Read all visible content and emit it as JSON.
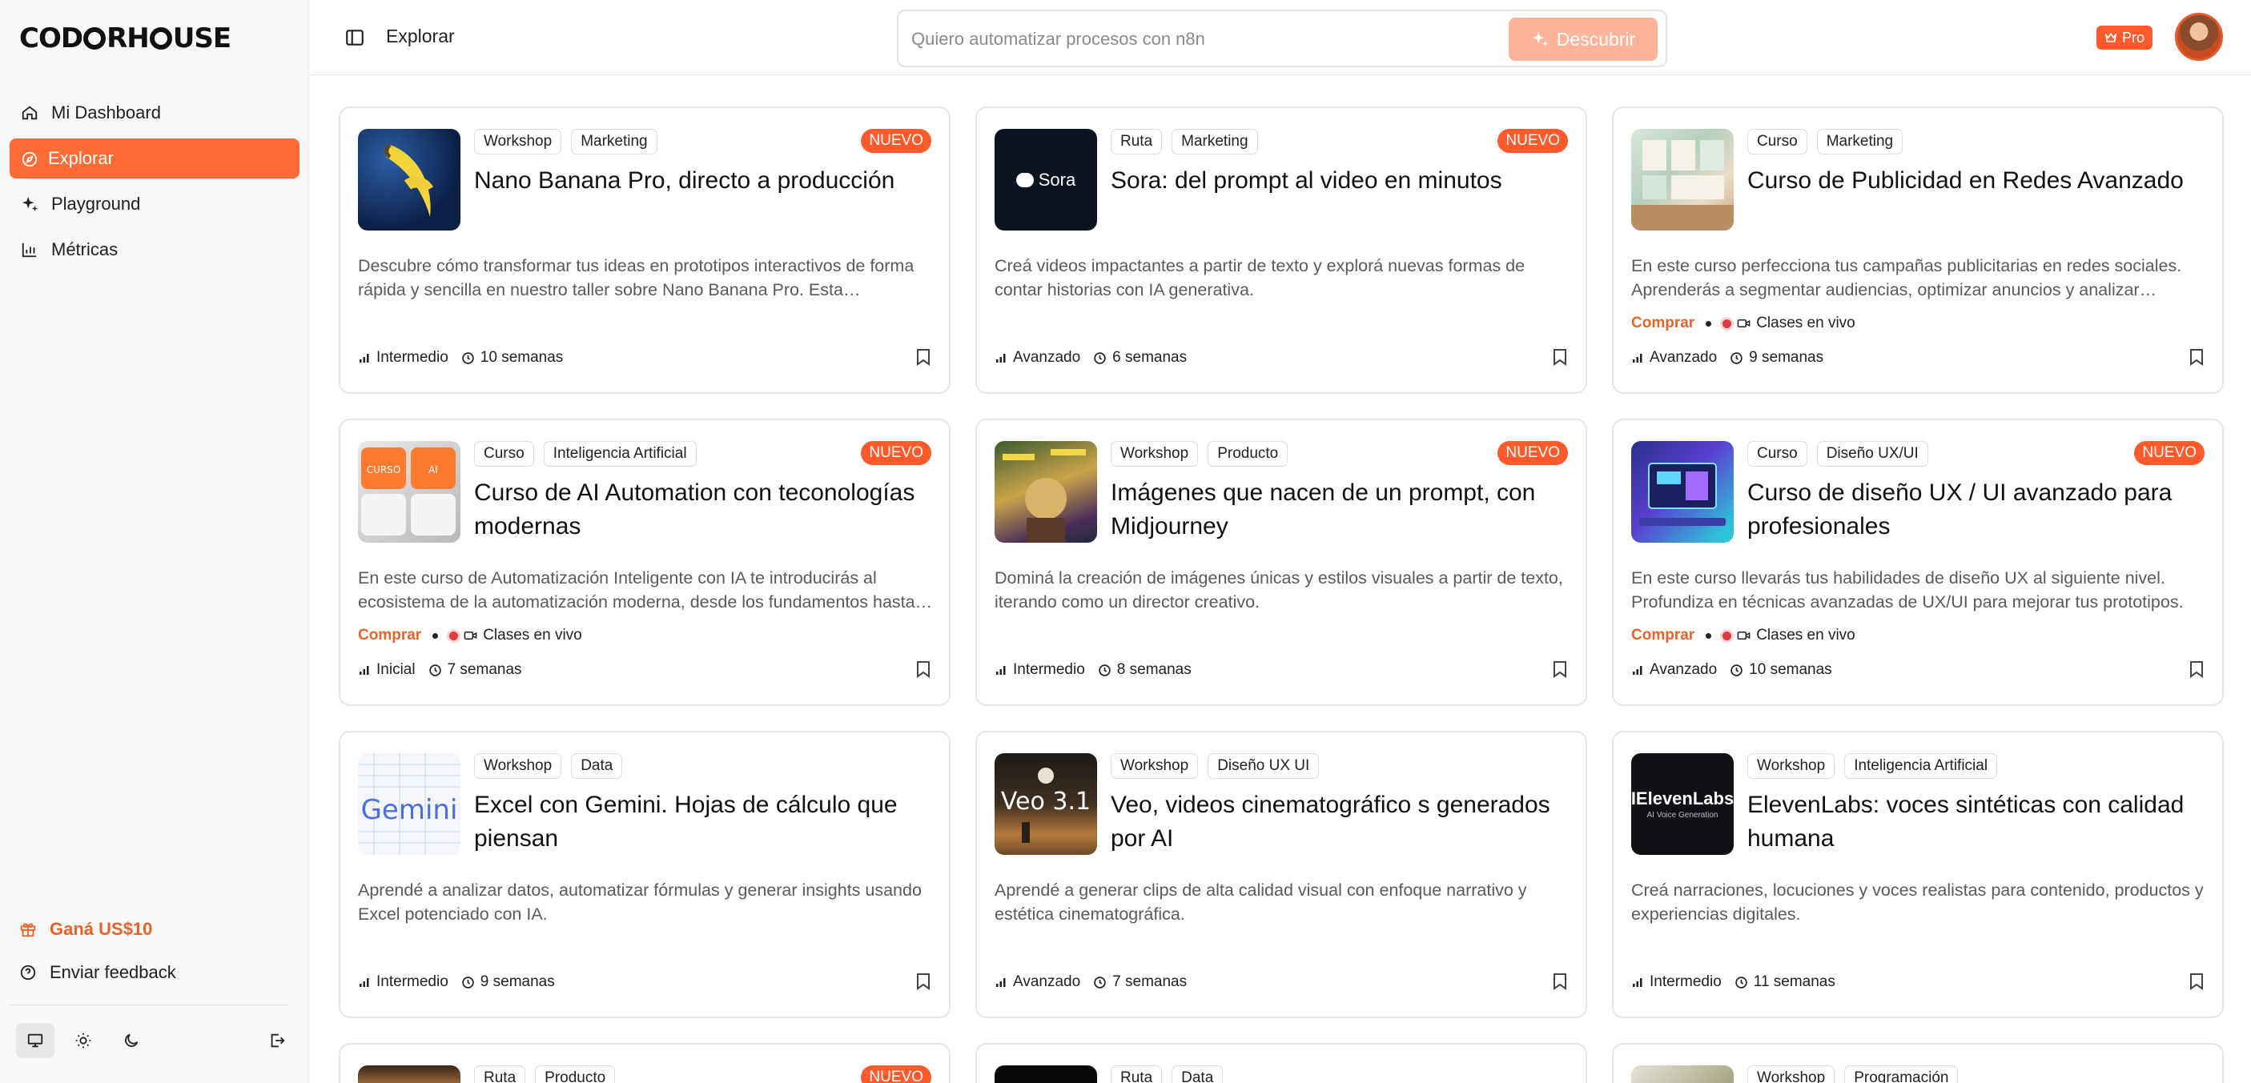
{
  "brand": {
    "logo_pre": "COD",
    "logo_post": "RH",
    "logo_end": "USE",
    "accent": "#ff6b35"
  },
  "sidebar": {
    "items": [
      {
        "label": "Mi Dashboard",
        "icon": "home-icon"
      },
      {
        "label": "Explorar",
        "icon": "compass-icon",
        "active": true
      },
      {
        "label": "Playground",
        "icon": "sparkles-icon"
      },
      {
        "label": "Métricas",
        "icon": "bar-chart-icon"
      }
    ],
    "gift_label": "Ganá US$10",
    "feedback_label": "Enviar feedback"
  },
  "header": {
    "breadcrumb": "Explorar",
    "search_placeholder": "Quiero automatizar procesos con n8n",
    "discover_label": "Descubrir",
    "pro_label": "Pro"
  },
  "cards": [
    {
      "tags": [
        "Workshop",
        "Marketing"
      ],
      "new": "NUEVO",
      "title": "Nano Banana Pro, directo a producción",
      "desc": "Descubre cómo transformar tus ideas en prototipos interactivos de forma rápida y sencilla en nuestro taller sobre Nano Banana Pro. Esta experiencia práctica te guiará paso a paso.",
      "level": "Intermedio",
      "duration": "10 semanas"
    },
    {
      "tags": [
        "Ruta",
        "Marketing"
      ],
      "new": "NUEVO",
      "title": "Sora: del prompt al video en minutos",
      "desc": "Creá videos impactantes a partir de texto y explorá nuevas formas de contar historias con IA generativa.",
      "level": "Avanzado",
      "duration": "6 semanas",
      "thumb_text": "Sora"
    },
    {
      "tags": [
        "Curso",
        "Marketing"
      ],
      "title": "Curso de Publicidad en Redes Avanzado",
      "desc": "En este curso perfecciona tus campañas publicitarias en redes sociales. Aprenderás a segmentar audiencias, optimizar anuncios y analizar resultados.",
      "buy": "Comprar",
      "live": "Clases en vivo",
      "level": "Avanzado",
      "duration": "9 semanas"
    },
    {
      "tags": [
        "Curso",
        "Inteligencia Artificial"
      ],
      "new": "NUEVO",
      "title": "Curso de AI Automation con teconologías modernas",
      "desc": "En este curso de Automatización Inteligente con IA te introducirás al ecosistema de la automatización moderna, desde los fundamentos hasta casos reales.",
      "buy": "Comprar",
      "live": "Clases en vivo",
      "level": "Inicial",
      "duration": "7 semanas",
      "thumb_text": "CURSO",
      "thumb_text2": "AI"
    },
    {
      "tags": [
        "Workshop",
        "Producto"
      ],
      "new": "NUEVO",
      "title": "Imágenes que nacen de un prompt, con Midjourney",
      "desc": "Dominá la creación de imágenes únicas y estilos visuales a partir de texto, iterando como un director creativo.",
      "level": "Intermedio",
      "duration": "8 semanas"
    },
    {
      "tags": [
        "Curso",
        "Diseño UX/UI"
      ],
      "new": "NUEVO",
      "title": "Curso de diseño UX / UI avanzado para profesionales",
      "desc": "En este curso llevarás tus habilidades de diseño UX al siguiente nivel. Profundiza en técnicas avanzadas de UX/UI para mejorar tus prototipos.",
      "buy": "Comprar",
      "live": "Clases en vivo",
      "level": "Avanzado",
      "duration": "10 semanas"
    },
    {
      "tags": [
        "Workshop",
        "Data"
      ],
      "title": "Excel con Gemini. Hojas de cálculo que piensan",
      "desc": "Aprendé a analizar datos, automatizar fórmulas y generar insights usando Excel potenciado con IA.",
      "level": "Intermedio",
      "duration": "9 semanas",
      "thumb_text": "Gemini"
    },
    {
      "tags": [
        "Workshop",
        "Diseño UX UI"
      ],
      "title": "Veo, videos cinematográfico s generados por AI",
      "desc": "Aprendé a generar clips de alta calidad visual con enfoque narrativo y estética cinematográfica.",
      "level": "Avanzado",
      "duration": "7 semanas",
      "thumb_text": "Veo 3.1"
    },
    {
      "tags": [
        "Workshop",
        "Inteligencia Artificial"
      ],
      "title": "ElevenLabs: voces sintéticas con calidad humana",
      "desc": "Creá narraciones, locuciones y voces realistas para contenido, productos y experiencias digitales.",
      "level": "Intermedio",
      "duration": "11 semanas",
      "thumb_text": "IElevenLabs",
      "thumb_text2": "AI Voice Generation"
    },
    {
      "tags": [
        "Ruta",
        "Producto"
      ],
      "new": "NUEVO"
    },
    {
      "tags": [
        "Ruta",
        "Data"
      ]
    },
    {
      "tags": [
        "Workshop",
        "Programación"
      ]
    }
  ]
}
